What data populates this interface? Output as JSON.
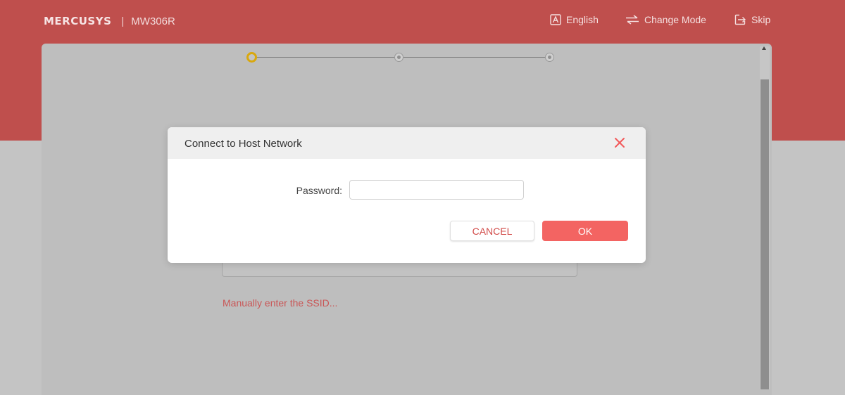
{
  "header": {
    "brand": "MERCUSYS",
    "separator": "|",
    "model": "MW306R",
    "nav": {
      "language": {
        "label": "English",
        "icon": "language-a-icon"
      },
      "change_mode": {
        "label": "Change Mode",
        "icon": "swap-arrows-icon"
      },
      "skip": {
        "label": "Skip",
        "icon": "exit-arrow-icon"
      }
    }
  },
  "wizard": {
    "steps_total": 3,
    "current_step": 1,
    "manual_link": "Manually enter the SSID..."
  },
  "dialog": {
    "title": "Connect to Host Network",
    "password_label": "Password:",
    "password_value": "",
    "cancel_label": "CANCEL",
    "ok_label": "OK"
  },
  "colors": {
    "header_band": "#bf4f4d",
    "accent": "#f36462",
    "active_step": "#d9a80f",
    "overlay_bg": "#c4c4c4"
  }
}
